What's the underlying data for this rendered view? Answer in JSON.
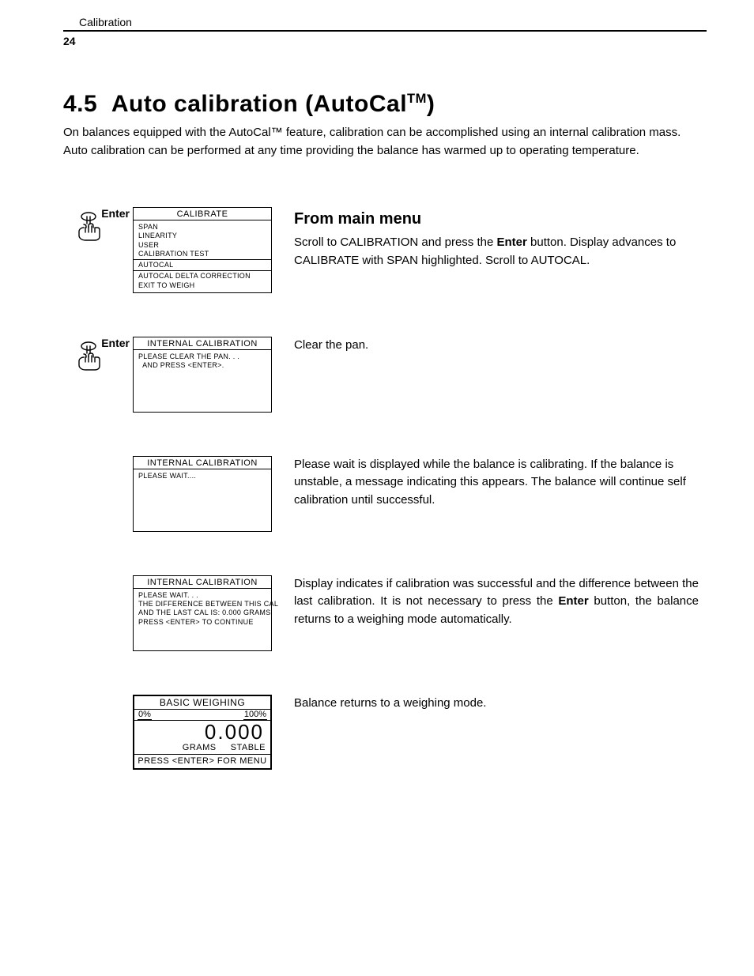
{
  "header": {
    "section": "Calibration",
    "page_number": "24"
  },
  "title": {
    "number": "4.5",
    "text_pre": "Auto calibration (AutoCal",
    "tm": "TM",
    "text_post": ")"
  },
  "intro": "On balances equipped with the AutoCal™ feature, calibration can be accomplished using an internal calibration mass. Auto calibration can be performed at any time providing the balance has warmed up to operating temperature.",
  "enter_label": "Enter",
  "steps": [
    {
      "has_hand": true,
      "display": {
        "title": "CALIBRATE",
        "groups": [
          [
            "SPAN",
            "LINEARITY",
            "USER",
            "CALIBRATION TEST"
          ],
          [
            "AUTOCAL"
          ],
          [
            "AUTOCAL DELTA CORRECTION",
            "EXIT TO WEIGH"
          ]
        ]
      },
      "subhead": "From main menu",
      "text_html": "Scroll to CALIBRATION and press the <b>Enter</b> button. Display advances to CALIBRATE with SPAN highlighted. Scroll to AUTOCAL."
    },
    {
      "has_hand": true,
      "display": {
        "title": "INTERNAL CALIBRATION",
        "lines": [
          "PLEASE CLEAR THE PAN. . .",
          "  AND PRESS <ENTER>."
        ]
      },
      "text_html": "Clear the pan."
    },
    {
      "has_hand": false,
      "display": {
        "title": "INTERNAL CALIBRATION",
        "lines": [
          "PLEASE WAIT...."
        ]
      },
      "text_html": "Please wait is displayed while the balance is calibrating. If the balance is unstable, a message indicating this appears. The balance will continue self calibration until successful."
    },
    {
      "has_hand": false,
      "display": {
        "title": "INTERNAL CALIBRATION",
        "lines": [
          "PLEASE WAIT. . .",
          "THE DIFFERENCE BETWEEN THIS CAL",
          "AND THE LAST CAL IS: 0.000 GRAMS",
          "PRESS <ENTER> TO CONTINUE"
        ]
      },
      "text_html": "Display indicates if calibration was successful and the difference between the last calibration. It is not necessary to press the <b>Enter</b> button, the balance returns to a weighing mode automatically.",
      "justify": true
    },
    {
      "has_hand": false,
      "weigh": {
        "title": "BASIC WEIGHING",
        "scale_left": "0%",
        "scale_right": "100%",
        "value": "0.000",
        "unit_left": "GRAMS",
        "unit_right": "STABLE",
        "footer": "PRESS <ENTER> FOR MENU"
      },
      "text_html": "Balance returns to a weighing mode."
    }
  ]
}
